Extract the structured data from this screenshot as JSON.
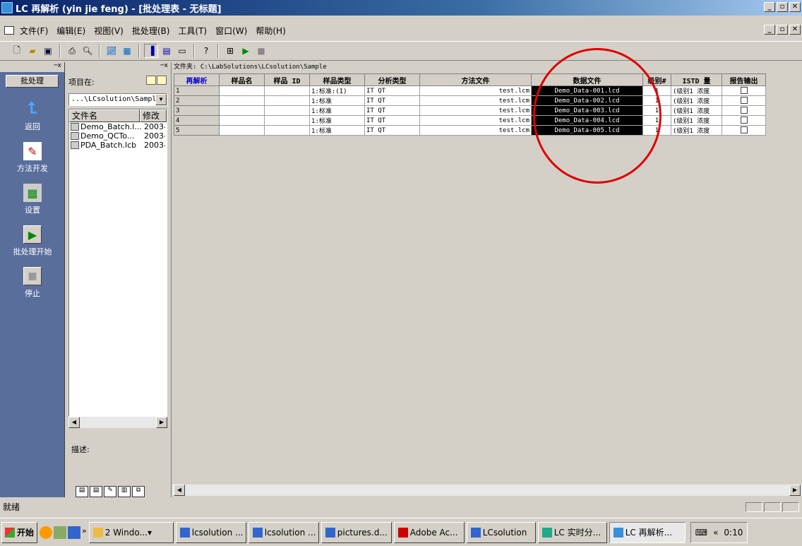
{
  "window": {
    "title": "LC 再解析 (yin jie feng) - [批处理表 - 无标题]"
  },
  "menu": [
    "文件(F)",
    "编辑(E)",
    "视图(V)",
    "批处理(B)",
    "工具(T)",
    "窗口(W)",
    "帮助(H)"
  ],
  "toolbar": {
    "icons": [
      "new-icon",
      "open-icon",
      "save-icon",
      "print-icon",
      "print-preview-icon",
      "chart-icon",
      "chart2-icon",
      "layout-icon",
      "grid-icon",
      "window-icon",
      "help-icon",
      "run-setup-icon",
      "play-icon",
      "stop-icon"
    ]
  },
  "leftbar": {
    "tab": "批处理",
    "buttons": [
      {
        "label": "返回",
        "icon": "back-arrow-icon"
      },
      {
        "label": "方法开发",
        "icon": "method-dev-icon"
      },
      {
        "label": "设置",
        "icon": "settings-icon"
      },
      {
        "label": "批处理开始",
        "icon": "batch-start-icon"
      },
      {
        "label": "停止",
        "icon": "stop-icon"
      }
    ]
  },
  "explorer": {
    "label": "项目在:",
    "path": "...\\LCsolution\\Sample",
    "columns": [
      "文件名",
      "修改"
    ],
    "files": [
      {
        "name": "Demo_Batch.l...",
        "modified": "2003-"
      },
      {
        "name": "Demo_QCTo...",
        "modified": "2003-"
      },
      {
        "name": "PDA_Batch.lcb",
        "modified": "2003-"
      }
    ],
    "description_label": "描述:"
  },
  "batch": {
    "folder": "文件夹: C:\\LabSolutions\\LCsolution\\Sample",
    "headers": [
      "再解析",
      "样品名",
      "样品 ID",
      "样品类型",
      "分析类型",
      "方法文件",
      "数据文件",
      "级别#",
      "ISTD 量",
      "报告输出"
    ],
    "rows": [
      {
        "num": "1",
        "name": "",
        "id": "",
        "type": "1:标准:(I)",
        "analysis": "IT QT",
        "method": "test.lcm",
        "data": "Demo_Data-001.lcd",
        "level": "1",
        "istd": "(级别1 浓度"
      },
      {
        "num": "2",
        "name": "",
        "id": "",
        "type": "1:标准",
        "analysis": "IT QT",
        "method": "test.lcm",
        "data": "Demo_Data-002.lcd",
        "level": "1",
        "istd": "(级别1 浓度"
      },
      {
        "num": "3",
        "name": "",
        "id": "",
        "type": "1:标准",
        "analysis": "IT QT",
        "method": "test.lcm",
        "data": "Demo_Data-003.lcd",
        "level": "1",
        "istd": "(级别1 浓度"
      },
      {
        "num": "4",
        "name": "",
        "id": "",
        "type": "1:标准",
        "analysis": "IT QT",
        "method": "test.lcm",
        "data": "Demo_Data-004.lcd",
        "level": "1",
        "istd": "(级别1 浓度"
      },
      {
        "num": "5",
        "name": "",
        "id": "",
        "type": "1:标准",
        "analysis": "IT QT",
        "method": "test.lcm",
        "data": "Demo_Data-005.lcd",
        "level": "1",
        "istd": "(级别1 浓度"
      }
    ]
  },
  "status": {
    "text": "就绪"
  },
  "taskbar": {
    "start": "开始",
    "tasks": [
      "2 Windo...",
      "lcsolution ...",
      "lcsolution ...",
      "pictures.d...",
      "Adobe Ac...",
      "LCsolution",
      "LC 实时分...",
      "LC 再解析..."
    ],
    "clock": "0:10"
  },
  "colors": {
    "title_bar": "#0a246a",
    "highlight": "#000000",
    "annotation": "#e00000",
    "nav_bg": "#5a6e9c"
  }
}
